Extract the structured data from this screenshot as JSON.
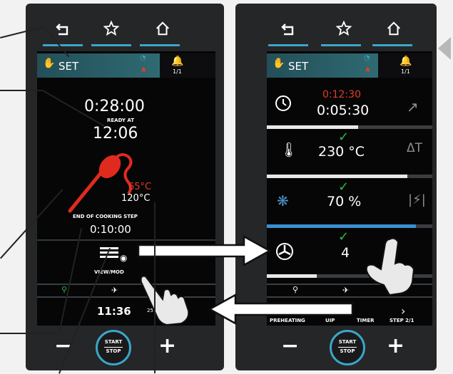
{
  "nav": {
    "back_icon": "back-arrow-icon",
    "favorite_icon": "star-icon",
    "home_icon": "home-icon"
  },
  "left": {
    "set_label": "SET",
    "status_count": "1/1",
    "cooking_time": "0:28:00",
    "ready_at_label": "READY AT",
    "ready_at_time": "12:06",
    "probe_temp": "65°C",
    "target_temp": "120°C",
    "end_step_label": "END OF COOKING STEP",
    "end_step_time": "0:10:00",
    "view_mode_label": "VIEW/MOD",
    "clock": "11:36",
    "clock_suffix": "25",
    "start_top": "START",
    "start_bottom": "STOP",
    "minus": "−",
    "plus": "+"
  },
  "right": {
    "set_label": "SET",
    "status_count": "1/1",
    "timer_elapsed": "0:12:30",
    "timer_total": "0:05:30",
    "temperature": "230 °C",
    "humidity": "70 %",
    "fan_speed": "4",
    "bottom_tabs": [
      "PREHEATING",
      "UIP",
      "TIMER",
      "STEP 2/1"
    ],
    "start_top": "START",
    "start_bottom": "STOP",
    "minus": "−",
    "plus": "+",
    "progress": {
      "timer": 0.55,
      "temperature": 0.85,
      "humidity": 0.9,
      "fan": 0.3
    }
  },
  "colors": {
    "accent": "#3aa6c9",
    "alert": "#e33b2e",
    "ok": "#2eb84b",
    "panel": "#252628"
  }
}
